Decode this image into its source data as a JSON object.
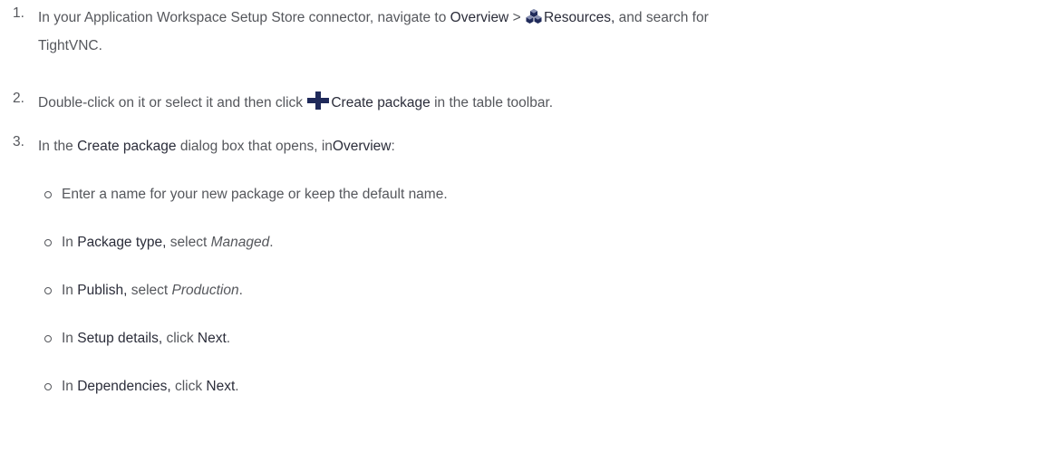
{
  "steps": [
    {
      "num": "1.",
      "t1": "In your Application Workspace Setup Store connector, navigate to ",
      "overview": "Overview",
      "sep": " > ",
      "resources": "Resources,",
      "t2": " and search for",
      "t3": "TightVNC."
    },
    {
      "num": "2.",
      "t1": "Double-click on it or select it and then click ",
      "create_package": "Create package",
      "t2": " in the table toolbar."
    },
    {
      "num": "3.",
      "t1": "In the ",
      "create_package": "Create package",
      "t2": " dialog box that opens, in",
      "overview": "Overview",
      "t3": ":"
    }
  ],
  "substeps": [
    {
      "text": "Enter a name for your new package or keep the default name."
    },
    {
      "t1": "In ",
      "ui": "Package type,",
      "t2": " select ",
      "em": "Managed",
      "t3": "."
    },
    {
      "t1": "In ",
      "ui": "Publish,",
      "t2": " select ",
      "em": "Production",
      "t3": "."
    },
    {
      "t1": "In ",
      "ui": "Setup details,",
      "t2": " click ",
      "ui2": "Next",
      "t3": "."
    },
    {
      "t1": "In ",
      "ui": "Dependencies,",
      "t2": " click ",
      "ui2": "Next",
      "t3": "."
    }
  ],
  "icons": {
    "resources": "resources-icon",
    "create_package": "plus-icon",
    "accent": "#1f2a5a"
  }
}
